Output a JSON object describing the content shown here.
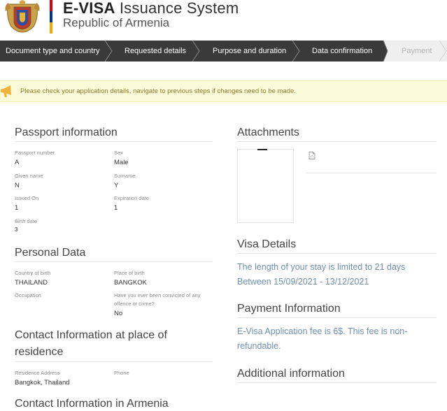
{
  "header": {
    "title_bold": "E-VISA",
    "title_rest": " Issuance System",
    "subtitle": "Republic of Armenia",
    "flag_colors": [
      "#d90012",
      "#0033a0",
      "#f2a800"
    ]
  },
  "steps": [
    {
      "label": "Document type and country",
      "state": "done"
    },
    {
      "label": "Requested details",
      "state": "done"
    },
    {
      "label": "Purpose and duration",
      "state": "done"
    },
    {
      "label": "Data confirmation",
      "state": "current"
    },
    {
      "label": "Payment",
      "state": "disabled"
    }
  ],
  "notice": {
    "text": "Please check your application details, navigate to previous steps if changes need to be made.",
    "icon": "megaphone-icon"
  },
  "passport": {
    "title": "Passport information",
    "number_label": "Passport number",
    "number_value": "A",
    "sex_label": "Sex",
    "sex_value": "Male",
    "given_label": "Given name",
    "given_value": "N",
    "surname_label": "Surname",
    "surname_value": "Y",
    "issued_label": "Issued On",
    "issued_value": "1",
    "expiration_label": "Expiration date",
    "expiration_value": "1",
    "birth_label": "Birth date",
    "birth_value": "3"
  },
  "personal": {
    "title": "Personal Data",
    "country_label": "Country of birth",
    "country_value": "THAILAND",
    "place_label": "Place of birth",
    "place_value": "BANGKOK",
    "occupation_label": "Occupation",
    "convicted_label_1": "Have you ever been convicted of any",
    "convicted_label_2": "offence or crime?",
    "convicted_value": "No"
  },
  "contact_residence": {
    "title_line1": "Contact Information at place of",
    "title_line2": "residence",
    "address_label": "Residence Address",
    "address_value": "Bangkok, Thailand",
    "phone_label": "Phone"
  },
  "contact_armenia": {
    "title": "Contact Information in Armenia"
  },
  "attachments": {
    "title": "Attachments",
    "file_icon": "pdf-file-icon"
  },
  "visa_details": {
    "title": "Visa Details",
    "line1": "The length of your stay is limited to 21 days",
    "line2": "Between 15/09/2021 - 13/12/2021"
  },
  "payment_info": {
    "title": "Payment Information",
    "line1": "E-Visa Application fee is 6$. This fee is non-",
    "line2": "refundable."
  },
  "additional": {
    "title": "Additional information"
  }
}
